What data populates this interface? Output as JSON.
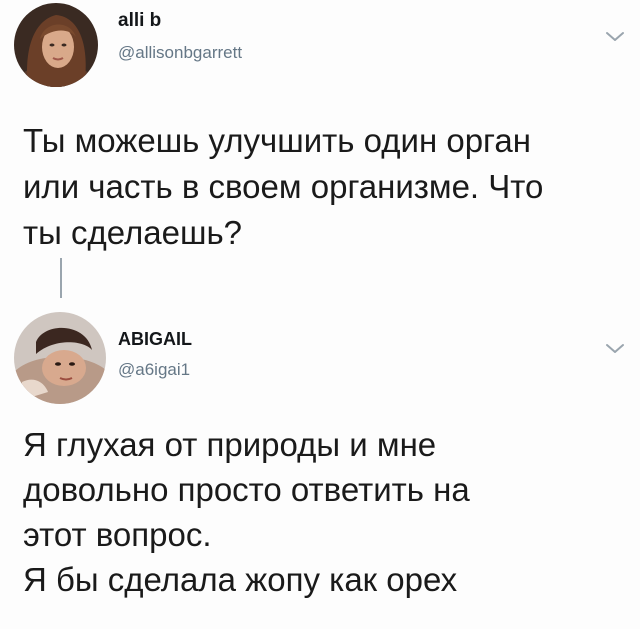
{
  "tweet1": {
    "display_name": "alli b",
    "handle": "@allisonbgarrett",
    "text_lines": [
      "Ты можешь улучшить один орган",
      "или часть в своем организме. Что",
      "ты сделаешь?"
    ]
  },
  "tweet2": {
    "display_name": "ABIGAIL",
    "handle": "@a6igai1",
    "text_lines": [
      "Я глухая от природы и мне",
      "довольно просто ответить на",
      "этот вопрос.",
      "Я бы сделала жопу как орех"
    ]
  },
  "icons": {
    "menu": "chevron-down-icon",
    "avatar": "profile-photo"
  },
  "colors": {
    "text": "#14171a",
    "handle": "#657786",
    "thread_line": "#9aa5ae"
  }
}
